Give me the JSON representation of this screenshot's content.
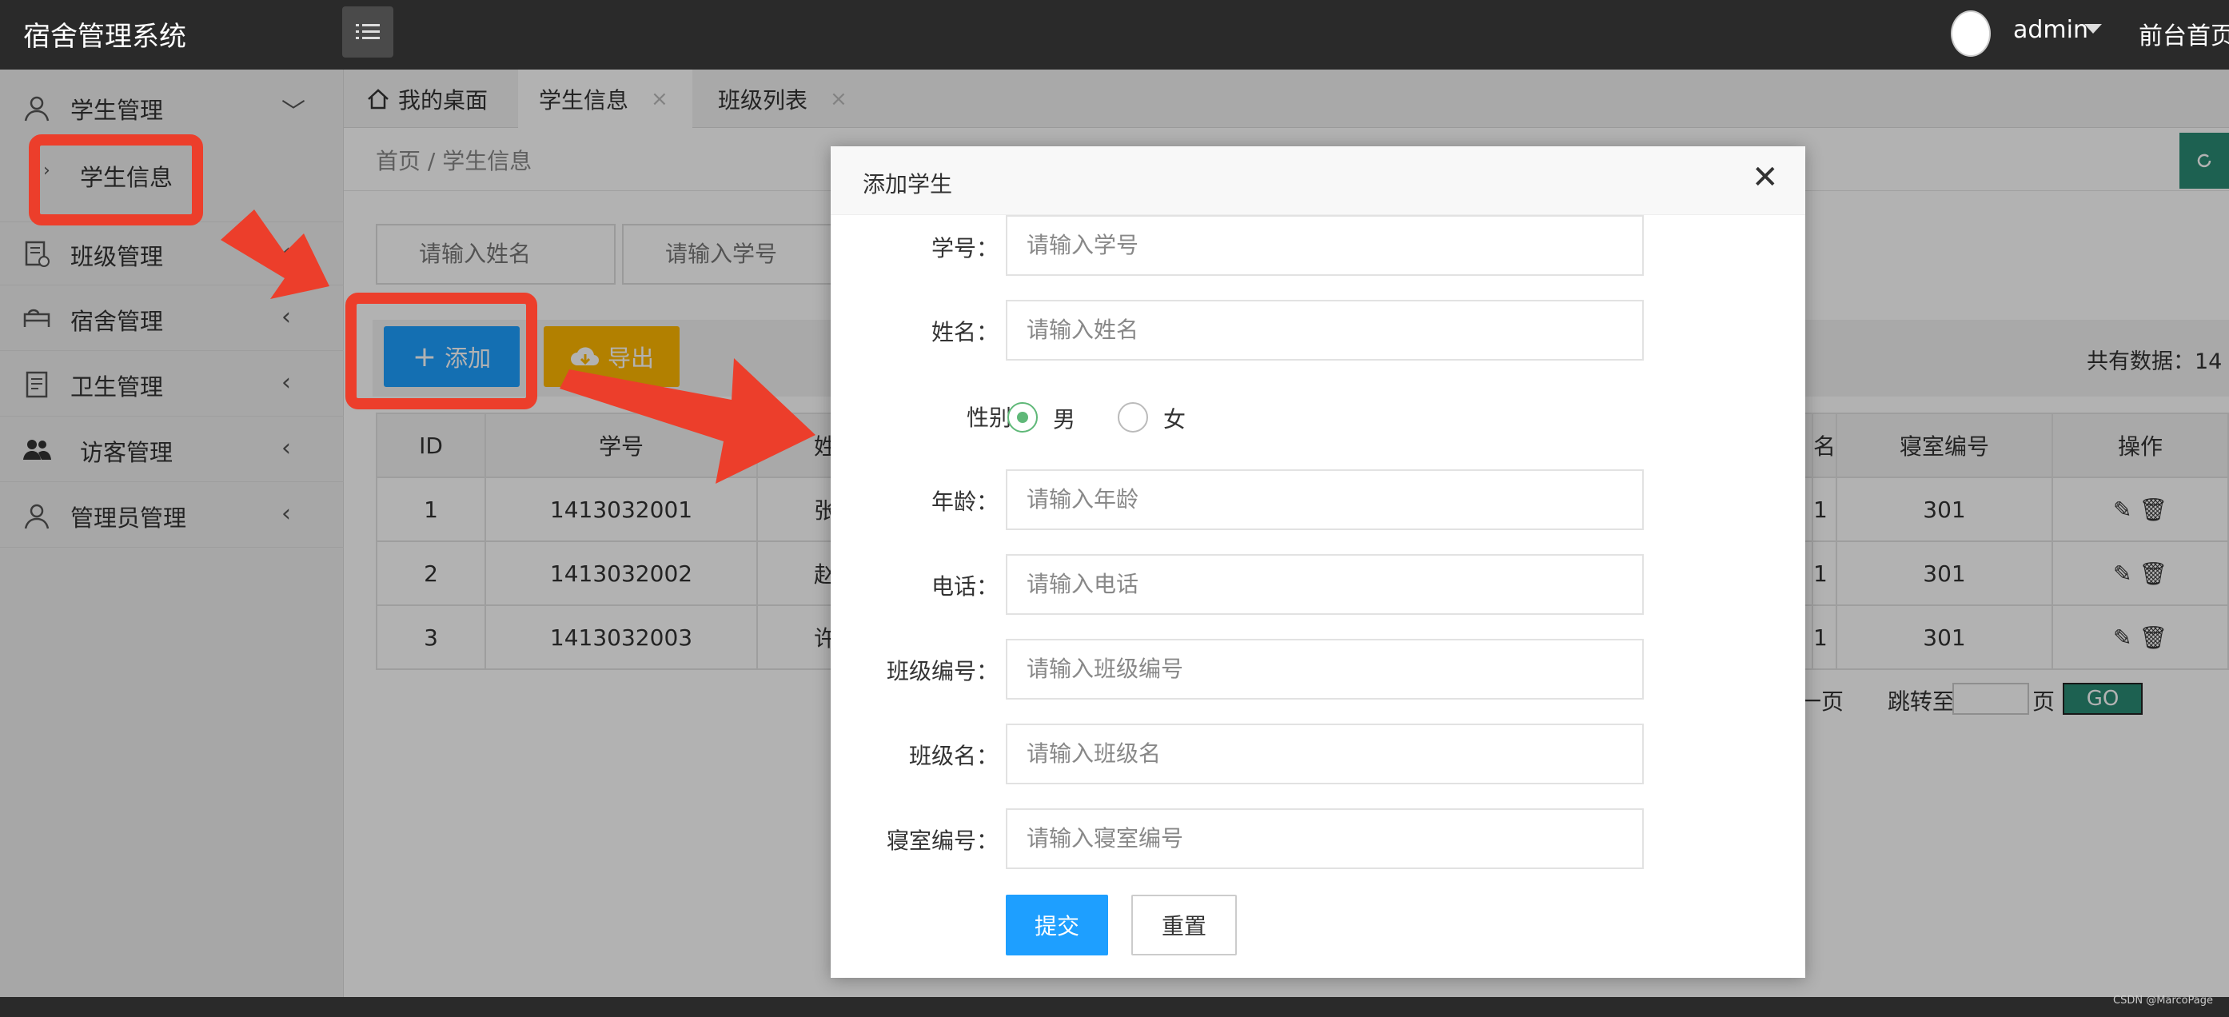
{
  "app_title": "宿舍管理系统",
  "header": {
    "user": "admin",
    "front_link": "前台首页"
  },
  "sidebar": {
    "items": [
      {
        "label": "学生管理",
        "chevron": "﹀"
      },
      {
        "label": "班级管理",
        "chevron": "‹"
      },
      {
        "label": "宿舍管理",
        "chevron": "‹"
      },
      {
        "label": "卫生管理",
        "chevron": "‹"
      },
      {
        "label": "访客管理",
        "chevron": "‹"
      },
      {
        "label": "管理员管理",
        "chevron": "‹"
      }
    ],
    "sub_item": {
      "label": "学生信息",
      "arrow": "›"
    }
  },
  "tabs": [
    {
      "label": "我的桌面"
    },
    {
      "label": "学生信息",
      "close": "×"
    },
    {
      "label": "班级列表",
      "close": "×"
    }
  ],
  "breadcrumb": "首页  /  学生信息",
  "search": {
    "name_placeholder": "请输入姓名",
    "id_placeholder": "请输入学号"
  },
  "toolbar": {
    "add_label": "添加",
    "export_label": "导出",
    "total": "共有数据：14"
  },
  "table": {
    "headers": [
      "ID",
      "学号",
      "姓",
      "名",
      "寝室编号",
      "操作"
    ],
    "rows": [
      {
        "id": "1",
        "number": "1413032001",
        "name": "张",
        "class": "1",
        "room": "301"
      },
      {
        "id": "2",
        "number": "1413032002",
        "name": "赵",
        "class": "1",
        "room": "301"
      },
      {
        "id": "3",
        "number": "1413032003",
        "name": "许",
        "class": "1",
        "room": "301"
      }
    ]
  },
  "pager": {
    "prev": "一页",
    "jump": "跳转至",
    "page": "页",
    "go": "GO"
  },
  "modal": {
    "title": "添加学生",
    "close": "✕",
    "fields": [
      {
        "label": "学号：",
        "placeholder": "请输入学号"
      },
      {
        "label": "姓名：",
        "placeholder": "请输入姓名"
      },
      {
        "label": "年龄：",
        "placeholder": "请输入年龄"
      },
      {
        "label": "电话：",
        "placeholder": "请输入电话"
      },
      {
        "label": "班级编号：",
        "placeholder": "请输入班级编号"
      },
      {
        "label": "班级名：",
        "placeholder": "请输入班级名"
      },
      {
        "label": "寝室编号：",
        "placeholder": "请输入寝室编号"
      }
    ],
    "gender": {
      "label": "性别",
      "male": "男",
      "female": "女",
      "selected": "男"
    },
    "submit": "提交",
    "reset": "重置"
  },
  "watermark": "CSDN @MarcoPage",
  "colors": {
    "highlight": "#ec3e2b",
    "primary": "#1e9fff",
    "warning": "#ffb800",
    "green": "#2a8c74"
  }
}
